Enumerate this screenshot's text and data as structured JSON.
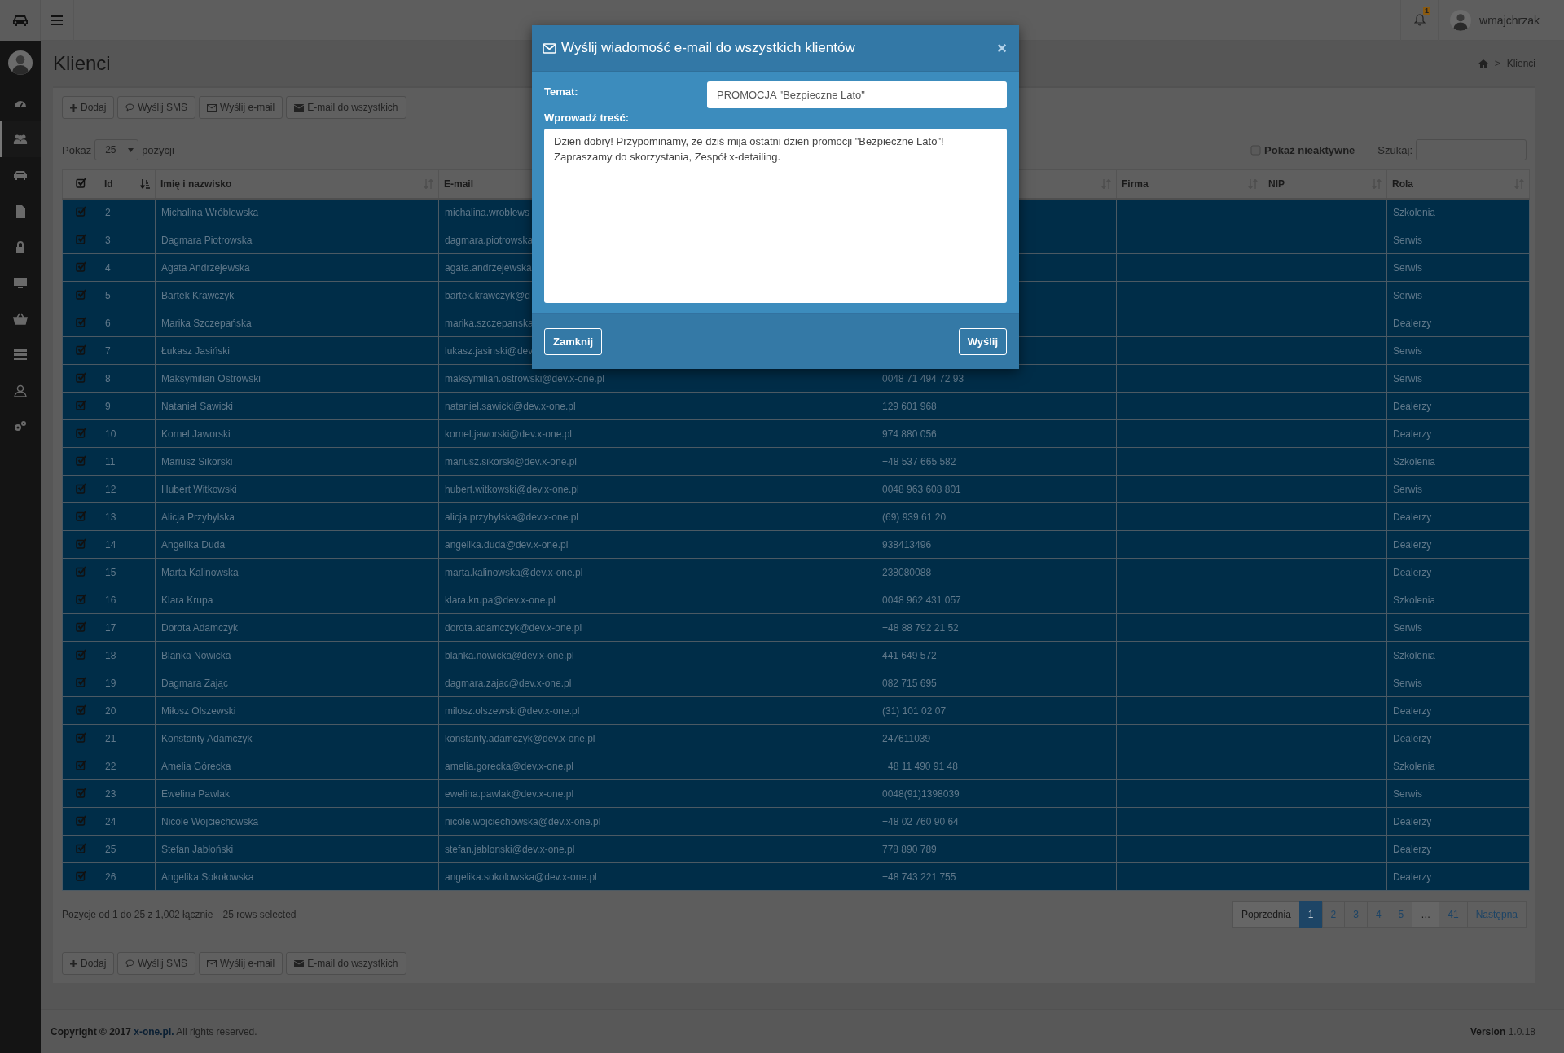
{
  "top_bar": {
    "notifications_badge": "1",
    "username": "wmajchrzak"
  },
  "sidebar": {
    "items": [
      {
        "selected": false
      },
      {
        "selected": true
      },
      {
        "selected": false
      },
      {
        "selected": false
      },
      {
        "selected": false
      },
      {
        "selected": false
      },
      {
        "selected": false
      },
      {
        "selected": false
      },
      {
        "selected": false
      },
      {
        "selected": false
      }
    ]
  },
  "page": {
    "title": "Klienci",
    "breadcrumb_separator": ">",
    "breadcrumb": "Klienci"
  },
  "toolbar_top": [
    {
      "kind": "add",
      "label": "Dodaj"
    },
    {
      "kind": "sms",
      "label": "Wyślij SMS"
    },
    {
      "kind": "email",
      "label": "Wyślij e-mail"
    },
    {
      "kind": "email_all",
      "label": "E-mail do wszystkich"
    }
  ],
  "length_menu": {
    "label_before": "Pokaż",
    "value": "25",
    "label_after": "pozycji"
  },
  "show_inactive": {
    "label": "Pokaż nieaktywne",
    "checked": false
  },
  "search": {
    "label": "Szukaj:"
  },
  "table": {
    "select_all_checked": true,
    "columns": [
      {
        "label": "Id",
        "sorted": true
      },
      {
        "label": "Imię i nazwisko",
        "sorted": false
      },
      {
        "label": "E-mail"
      },
      {
        "sorted": false
      },
      {
        "label": "Firma",
        "sorted": false
      },
      {
        "label": "NIP",
        "sorted": false
      },
      {
        "label": "Rola",
        "sorted": false
      }
    ],
    "rows": [
      {
        "selected": true,
        "id": "2",
        "name": "Michalina Wróblewska",
        "email": "michalina.wroblews",
        "role": "Szkolenia"
      },
      {
        "selected": true,
        "id": "3",
        "name": "Dagmara Piotrowska",
        "email": "dagmara.piotrowska",
        "role": "Serwis"
      },
      {
        "selected": true,
        "id": "4",
        "name": "Agata Andrzejewska",
        "email": "agata.andrzejewska",
        "role": "Serwis"
      },
      {
        "selected": true,
        "id": "5",
        "name": "Bartek Krawczyk",
        "email": "bartek.krawczyk@d",
        "role": "Serwis"
      },
      {
        "selected": true,
        "id": "6",
        "name": "Marika Szczepańska",
        "email": "marika.szczepanska",
        "role": "Dealerzy"
      },
      {
        "selected": true,
        "id": "7",
        "name": "Łukasz Jasiński",
        "email": "lukasz.jasinski@dev",
        "role": "Serwis"
      },
      {
        "selected": true,
        "id": "8",
        "name": "Maksymilian Ostrowski",
        "email": "maksymilian.ostrowski@dev.x-one.pl",
        "phone": "0048 71 494 72 93",
        "role": "Serwis"
      },
      {
        "selected": true,
        "id": "9",
        "name": "Nataniel Sawicki",
        "email": "nataniel.sawicki@dev.x-one.pl",
        "phone": "129 601 968",
        "role": "Dealerzy"
      },
      {
        "selected": true,
        "id": "10",
        "name": "Kornel Jaworski",
        "email": "kornel.jaworski@dev.x-one.pl",
        "phone": "974 880 056",
        "role": "Dealerzy"
      },
      {
        "selected": true,
        "id": "11",
        "name": "Mariusz Sikorski",
        "email": "mariusz.sikorski@dev.x-one.pl",
        "phone": "+48 537 665 582",
        "role": "Szkolenia"
      },
      {
        "selected": true,
        "id": "12",
        "name": "Hubert Witkowski",
        "email": "hubert.witkowski@dev.x-one.pl",
        "phone": "0048 963 608 801",
        "role": "Serwis"
      },
      {
        "selected": true,
        "id": "13",
        "name": "Alicja Przybylska",
        "email": "alicja.przybylska@dev.x-one.pl",
        "phone": "(69) 939 61 20",
        "role": "Dealerzy"
      },
      {
        "selected": true,
        "id": "14",
        "name": "Angelika Duda",
        "email": "angelika.duda@dev.x-one.pl",
        "phone": "938413496",
        "role": "Dealerzy"
      },
      {
        "selected": true,
        "id": "15",
        "name": "Marta Kalinowska",
        "email": "marta.kalinowska@dev.x-one.pl",
        "phone": "238080088",
        "role": "Dealerzy"
      },
      {
        "selected": true,
        "id": "16",
        "name": "Klara Krupa",
        "email": "klara.krupa@dev.x-one.pl",
        "phone": "0048 962 431 057",
        "role": "Szkolenia"
      },
      {
        "selected": true,
        "id": "17",
        "name": "Dorota Adamczyk",
        "email": "dorota.adamczyk@dev.x-one.pl",
        "phone": "+48 88 792 21 52",
        "role": "Serwis"
      },
      {
        "selected": true,
        "id": "18",
        "name": "Blanka Nowicka",
        "email": "blanka.nowicka@dev.x-one.pl",
        "phone": "441 649 572",
        "role": "Szkolenia"
      },
      {
        "selected": true,
        "id": "19",
        "name": "Dagmara Zając",
        "email": "dagmara.zajac@dev.x-one.pl",
        "phone": "082 715 695",
        "role": "Serwis"
      },
      {
        "selected": true,
        "id": "20",
        "name": "Miłosz Olszewski",
        "email": "milosz.olszewski@dev.x-one.pl",
        "phone": "(31) 101 02 07",
        "role": "Dealerzy"
      },
      {
        "selected": true,
        "id": "21",
        "name": "Konstanty Adamczyk",
        "email": "konstanty.adamczyk@dev.x-one.pl",
        "phone": "247611039",
        "role": "Dealerzy"
      },
      {
        "selected": true,
        "id": "22",
        "name": "Amelia Górecka",
        "email": "amelia.gorecka@dev.x-one.pl",
        "phone": "+48 11 490 91 48",
        "role": "Szkolenia"
      },
      {
        "selected": true,
        "id": "23",
        "name": "Ewelina Pawlak",
        "email": "ewelina.pawlak@dev.x-one.pl",
        "phone": "0048(91)1398039",
        "role": "Serwis"
      },
      {
        "selected": true,
        "id": "24",
        "name": "Nicole Wojciechowska",
        "email": "nicole.wojciechowska@dev.x-one.pl",
        "phone": "+48 02 760 90 64",
        "role": "Dealerzy"
      },
      {
        "selected": true,
        "id": "25",
        "name": "Stefan Jabłoński",
        "email": "stefan.jablonski@dev.x-one.pl",
        "phone": "778 890 789",
        "role": "Dealerzy"
      },
      {
        "selected": true,
        "id": "26",
        "name": "Angelika Sokołowska",
        "email": "angelika.sokolowska@dev.x-one.pl",
        "phone": "+48 743 221 755",
        "role": "Dealerzy"
      }
    ]
  },
  "info": "Pozycje od 1 do 25 z 1,002 łącznie",
  "selection_info": "25 rows selected",
  "pagination": [
    {
      "label": "Poprzednia",
      "selected": false,
      "disabled": true
    },
    {
      "label": "1",
      "selected": true,
      "disabled": false
    },
    {
      "label": "2",
      "selected": false,
      "disabled": false
    },
    {
      "label": "3",
      "selected": false,
      "disabled": false
    },
    {
      "label": "4",
      "selected": false,
      "disabled": false
    },
    {
      "label": "5",
      "selected": false,
      "disabled": false
    },
    {
      "label": "…",
      "selected": false,
      "disabled": true
    },
    {
      "label": "41",
      "selected": false,
      "disabled": false
    },
    {
      "label": "Następna",
      "selected": false,
      "disabled": false
    }
  ],
  "toolbar_bottom": [
    {
      "kind": "add",
      "label": "Dodaj"
    },
    {
      "kind": "sms",
      "label": "Wyślij SMS"
    },
    {
      "kind": "email",
      "label": "Wyślij e-mail"
    },
    {
      "kind": "email_all",
      "label": "E-mail do wszystkich"
    }
  ],
  "footer": {
    "copyright": "Copyright © 2017",
    "link": "x-one.pl.",
    "rights": "All rights reserved.",
    "version_label": "Version",
    "version": "1.0.18"
  },
  "modal": {
    "title": "Wyślij wiadomość e-mail do wszystkich klientów",
    "close": "×",
    "subject_label": "Temat:",
    "subject": "PROMOCJA \"Bezpieczne Lato\"",
    "body_label": "Wprowadź treść:",
    "body": "Dzień dobry! Przypominamy, że dziś mija ostatni dzień promocji \"Bezpieczne Lato\"!\nZapraszamy do skorzystania, Zespół x-detailing.",
    "buttons": [
      "Zamknij",
      "Wyślij"
    ]
  }
}
